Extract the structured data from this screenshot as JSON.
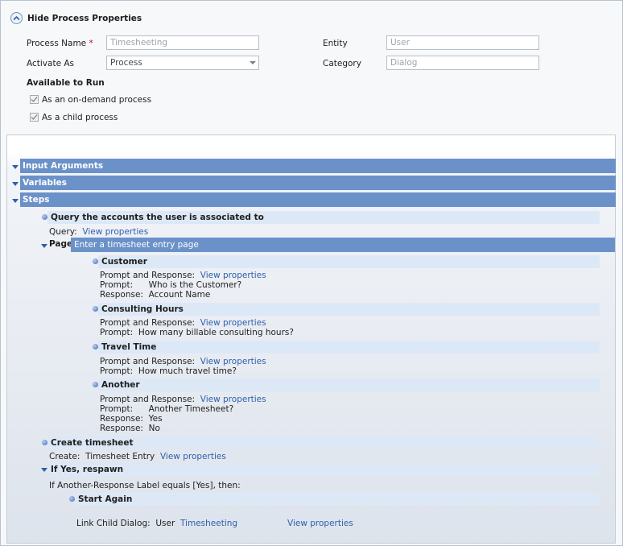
{
  "header": {
    "hide_label": "Hide Process Properties",
    "process_name_label": "Process Name",
    "required_mark": "*",
    "process_name_value": "Timesheeting",
    "activate_as_label": "Activate As",
    "activate_as_value": "Process",
    "entity_label": "Entity",
    "entity_value": "User",
    "category_label": "Category",
    "category_value": "Dialog",
    "available_label": "Available to Run",
    "on_demand_label": "As an on-demand process",
    "child_label": "As a child process"
  },
  "sections": {
    "input_arguments": "Input Arguments",
    "variables": "Variables",
    "steps": "Steps"
  },
  "steps": {
    "query_title": "Query the accounts the user is associated to",
    "query_label": "Query:",
    "page_label": "Page:",
    "page_title": "Enter a timesheet entry page",
    "prompt_response_label": "Prompt and Response:",
    "prompt_label": "Prompt:",
    "response_label": "Response:",
    "view_properties": "View properties",
    "customer_title": "Customer",
    "customer_prompt": "Who is the Customer?",
    "customer_response": "Account Name",
    "consulting_title": "Consulting Hours",
    "consulting_prompt": "How many billable consulting hours?",
    "travel_title": "Travel Time",
    "travel_prompt": "How much travel time?",
    "another_title": "Another",
    "another_prompt": "Another Timesheet?",
    "another_response_yes": "Yes",
    "another_response_no": "No",
    "create_title": "Create timesheet",
    "create_label": "Create:",
    "create_value": "Timesheet Entry",
    "ifyes_title": "If Yes, respawn",
    "condition_text": "If Another-Response Label equals [Yes], then:",
    "start_again_title": "Start Again",
    "link_child_label": "Link Child Dialog:",
    "link_child_entity": "User",
    "link_child_dialog": "Timesheeting"
  },
  "colors": {
    "section_bar": "#6b91c9",
    "row_bar": "#dde8f7",
    "link": "#2d5fae",
    "required": "#d0021b"
  }
}
